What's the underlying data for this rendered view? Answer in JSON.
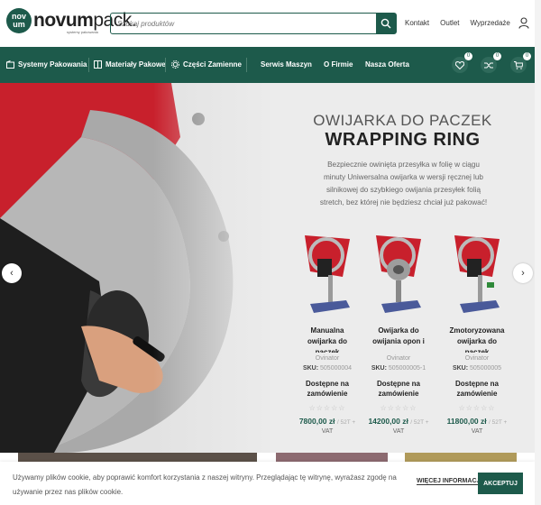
{
  "header": {
    "logo": {
      "badge": "nov um",
      "name_bold": "novum",
      "name_light": "pack.",
      "tagline": "systemy pakowania"
    },
    "search": {
      "placeholder": "Szukaj produktów"
    },
    "links": [
      "Kontakt",
      "Outlet",
      "Wyprzedaże"
    ]
  },
  "nav": {
    "items": [
      "Systemy Pakowania",
      "Materiały Pakowe",
      "Części Zamienne",
      "Serwis Maszyn",
      "O Firmie",
      "Nasza Oferta"
    ],
    "wishlist_count": "0",
    "compare_count": "0",
    "cart_count": "0"
  },
  "hero": {
    "title_line1": "OWIJARKA DO PACZEK",
    "title_line2": "WRAPPING RING",
    "description": "Bezpiecznie owinięta przesyłka w folię w ciągu minuty Uniwersalna owijarka w wersji ręcznej lub silnikowej do szybkiego owijania przesyłek folią stretch, bez której nie będziesz chciał już pakować!",
    "prev_arrow": "‹",
    "next_arrow": "›"
  },
  "products": [
    {
      "name": "Manualna owijarka do paczek",
      "brand": "Ovinator",
      "sku_label": "SKU:",
      "sku": "505000004",
      "availability": "Dostępne na zamówienie",
      "stars": "☆☆☆☆☆",
      "price": "7800,00 zł",
      "price_note": "/ 52T +",
      "vat": "VAT"
    },
    {
      "name": "Owijarka do owijania opon i",
      "brand": "Ovinator",
      "sku_label": "SKU:",
      "sku": "505000005-1",
      "availability": "Dostępne na zamówienie",
      "stars": "☆☆☆☆☆",
      "price": "14200,00 zł",
      "price_note": "/ 52T +",
      "vat": "VAT"
    },
    {
      "name": "Zmotoryzowana owijarka do paczek",
      "brand": "Ovinator",
      "sku_label": "SKU:",
      "sku": "505000005",
      "availability": "Dostępne na zamówienie",
      "stars": "☆☆☆☆☆",
      "price": "11800,00 zł",
      "price_note": "/ 52T +",
      "vat": "VAT"
    }
  ],
  "cookie": {
    "text": "Używamy plików cookie, aby poprawić komfort korzystania z naszej witryny. Przeglądając tę witrynę, wyrażasz zgodę na używanie przez nas plików cookie.",
    "more_label": "WIĘCEJ INFORMACJI",
    "accept_label": "AKCEPTUJ"
  },
  "colors": {
    "brand": "#1d5a4b",
    "accent_red": "#c8202c"
  }
}
